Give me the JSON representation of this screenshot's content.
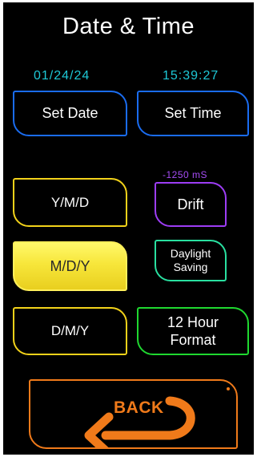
{
  "title": "Date & Time",
  "date_readout": "01/24/24",
  "time_readout": "15:39:27",
  "drift_readout": "-1250 mS",
  "buttons": {
    "set_date": "Set Date",
    "set_time": "Set Time",
    "ymd": "Y/M/D",
    "mdy": "M/D/Y",
    "dmy": "D/M/Y",
    "drift": "Drift",
    "daylight_line1": "Daylight",
    "daylight_line2": "Saving",
    "hour_line1": "12 Hour",
    "hour_line2": "Format",
    "back": "BACK"
  },
  "selected_date_format": "M/D/Y",
  "colors": {
    "background": "#000000",
    "readout": "#1ec8d6",
    "drift_readout": "#a64cf5",
    "set_buttons": "#1a6cf0",
    "date_format_buttons": "#f2d21a",
    "drift_button": "#9d3df5",
    "daylight_button": "#29e0a0",
    "hour_format_button": "#1fd830",
    "back_button": "#f07a1a"
  },
  "icons": {
    "back": "curved-back-arrow-icon"
  }
}
